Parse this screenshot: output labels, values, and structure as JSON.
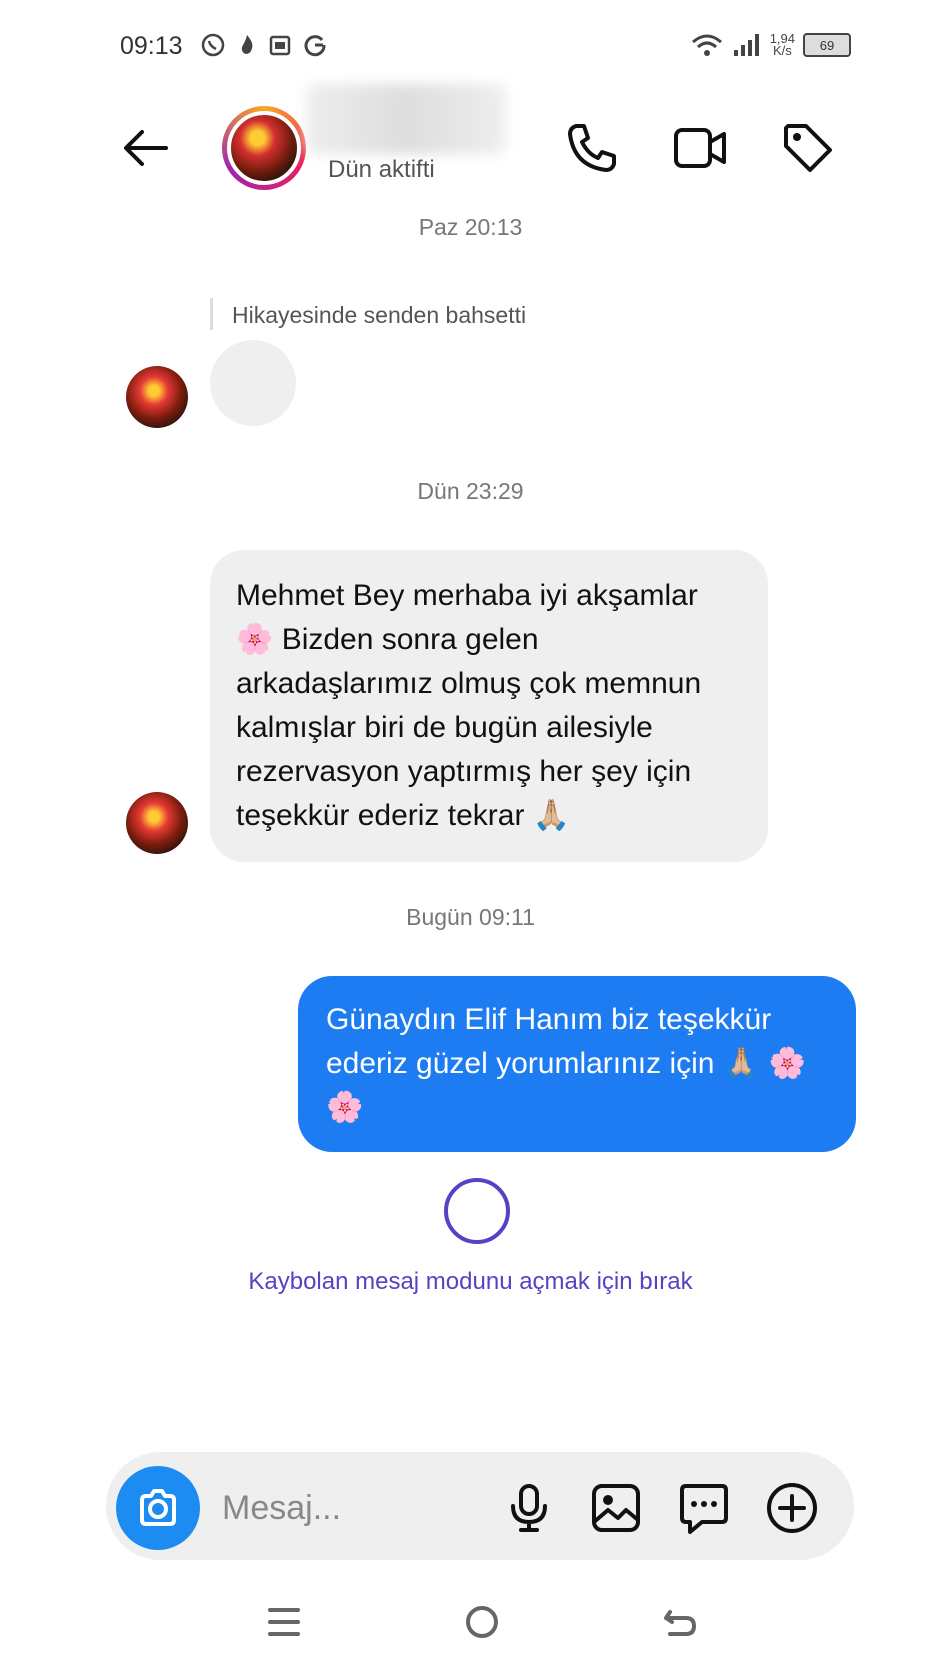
{
  "status_bar": {
    "time": "09:13",
    "speed_value": "1,94",
    "speed_unit": "K/s",
    "battery": "69"
  },
  "header": {
    "subtitle": "Dün aktifti"
  },
  "thread": {
    "ts1": "Paz 20:13",
    "story_mention": "Hikayesinde senden bahsetti",
    "ts2": "Dün 23:29",
    "incoming_message": "Mehmet Bey merhaba iyi akşamlar 🌸 Bizden sonra gelen arkadaşlarımız olmuş çok memnun kalmışlar biri de bugün ailesiyle rezervasyon yaptırmış her şey için teşekkür ederiz tekrar 🙏🏼",
    "ts3": "Bugün 09:11",
    "outgoing_message": "Günaydın Elif Hanım biz teşekkür ederiz güzel yorumlarınız için 🙏🏼 🌸🌸",
    "vanish_hint": "Kaybolan mesaj modunu açmak için bırak"
  },
  "composer": {
    "placeholder": "Mesaj..."
  },
  "icons": {
    "back": "arrow-left-icon",
    "call": "phone-icon",
    "video": "video-camera-icon",
    "tag": "tag-icon",
    "camera": "camera-icon",
    "mic": "microphone-icon",
    "gallery": "image-icon",
    "sticker": "chat-bubble-icon",
    "plus": "plus-circle-icon"
  },
  "colors": {
    "outgoing_bubble": "#1d7cf2",
    "incoming_bubble": "#efefef",
    "vanish_accent": "#5b3fc4",
    "camera_button": "#1d8cf2"
  }
}
